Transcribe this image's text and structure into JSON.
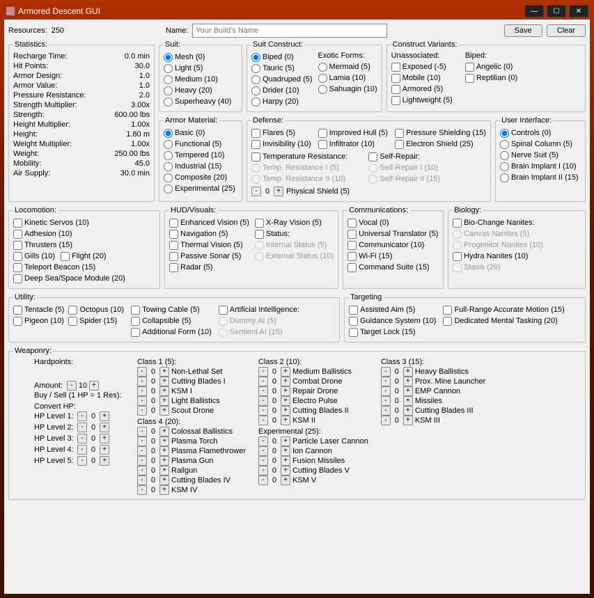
{
  "window": {
    "title": "Armored Descent GUI"
  },
  "top": {
    "resources_label": "Resources:",
    "resources_value": "250",
    "name_label": "Name:",
    "name_placeholder": "Your Build's Name",
    "save": "Save",
    "clear": "Clear"
  },
  "statistics": {
    "legend": "Statistics:",
    "rows": [
      [
        "Recharge Time:",
        "0.0 min"
      ],
      [
        "Hit Points:",
        "30.0"
      ],
      [
        "Armor Design:",
        "1.0"
      ],
      [
        "Armor Value:",
        "1.0"
      ],
      [
        "Pressure Resistance:",
        "2.0"
      ],
      [
        "Strength Multiplier:",
        "3.00x"
      ],
      [
        "Strength:",
        "600.00 lbs"
      ],
      [
        "Height Multiplier:",
        "1.00x"
      ],
      [
        "Height:",
        "1.80 m"
      ],
      [
        "Weight Multiplier:",
        "1.00x"
      ],
      [
        "Weight:",
        "250.00 lbs"
      ],
      [
        "Mobility:",
        "45.0"
      ],
      [
        "Air Supply:",
        "30.0 min"
      ]
    ]
  },
  "suit": {
    "legend": "Suit:",
    "options": [
      "Mesh (0)",
      "Light (5)",
      "Medium (10)",
      "Heavy (20)",
      "Superheavy (40)"
    ]
  },
  "suit_construct": {
    "legend": "Suit Construct:",
    "col1": [
      "Biped (0)",
      "Tauric (5)",
      "Quadruped (5)",
      "Drider (10)",
      "Harpy (20)"
    ],
    "exotic_header": "Exotic Forms:",
    "col2": [
      "Mermaid (5)",
      "Lamia (10)",
      "Sahuagin (10)"
    ]
  },
  "construct_variants": {
    "legend": "Construct Variants:",
    "unassoc_header": "Unassociated:",
    "unassoc": [
      "Exposed (-5)",
      "Mobile (10)",
      "Armored (5)",
      "Lightweight (5)"
    ],
    "biped_header": "Biped:",
    "biped": [
      "Angelic (0)",
      "Reptilian (0)"
    ]
  },
  "armor_material": {
    "legend": "Armor Material:",
    "options": [
      "Basic (0)",
      "Functional (5)",
      "Tempered (10)",
      "Industrial (15)",
      "Composite (20)",
      "Experimental (25)"
    ]
  },
  "defense": {
    "legend": "Defense:",
    "col1": [
      "Flares (5)",
      "Invisibility (10)"
    ],
    "col2": [
      "Improved Hull (5)",
      "Infiltrator (10)"
    ],
    "col3": [
      "Pressure Shielding (15)",
      "Electron Shield (25)"
    ],
    "temp_header": "Temperature Resistance:",
    "temp": [
      "Temp. Resistance I (5)",
      "Temp. Resistance II (10)"
    ],
    "self_header": "Self-Repair:",
    "self": [
      "Self-Repair I (10)",
      "Self-Repair II (15)"
    ],
    "phys_shield": "Physical Shield (5)",
    "phys_val": "0"
  },
  "ui": {
    "legend": "User Interface:",
    "options": [
      "Controls (0)",
      "Spinal Column (5)",
      "Nerve Suit (5)",
      "Brain Implant I (10)",
      "Brain Implant II (15)"
    ]
  },
  "locomotion": {
    "legend": "Locomotion:",
    "col1": [
      "Kinetic Servos (10)",
      "Adhesion (10)",
      "Thrusters (15)"
    ],
    "row": [
      "Gills (10)",
      "Flight (20)"
    ],
    "col2": [
      "Teleport Beacon (15)",
      "Deep Sea/Space Module (20)"
    ]
  },
  "hud": {
    "legend": "HUD/Visuals:",
    "col1": [
      "Enhanced Vision (5)",
      "Navigation (5)",
      "Thermal Vision (5)",
      "Passive Sonar (5)",
      "Radar (5)"
    ],
    "xray": "X-Ray Vision (5)",
    "status_header": "Status:",
    "status": [
      "Internal Status (5)",
      "External Status (10)"
    ]
  },
  "comm": {
    "legend": "Communications:",
    "options": [
      "Vocal (0)",
      "Universal Translator (5)",
      "Communicator (10)",
      "Wi-Fi (15)",
      "Command Suite (15)"
    ]
  },
  "biology": {
    "legend": "Biology:",
    "bio_header": "Bio-Change Nanites:",
    "bio": [
      "Canvas Nanites (5)",
      "Progenitor Nanites (10)"
    ],
    "hydra": "Hydra Nanites (10)",
    "stasis": "Stasis (20)"
  },
  "utility": {
    "legend": "Utility:",
    "col1": [
      [
        "Tentacle (5)",
        "Octopus (10)"
      ],
      [
        "Pigeon (10)",
        "Spider (15)"
      ]
    ],
    "col2": [
      "Towing Cable (5)",
      "Collapsible (5)",
      "Additional Form (10)"
    ],
    "ai_header": "Artificial Intelligence:",
    "ai": [
      "Dummy AI (5)",
      "Sentient AI (15)"
    ]
  },
  "targeting": {
    "legend": "Targeting",
    "col1": [
      "Assisted Aim (5)",
      "Guidance System (10)",
      "Target Lock (15)"
    ],
    "col2": [
      "Full-Range Accurate Motion (15)",
      "Dedicated Mental Tasking (20)"
    ]
  },
  "weaponry": {
    "legend": "Weaponry:",
    "hp_header": "Hardpoints:",
    "amount_label": "Amount:",
    "amount_val": "10",
    "buysell": "Buy / Sell (1 HP = 1 Res):",
    "convert_header": "Convert HP:",
    "convert": [
      "HP Level 1:",
      "HP Level 2:",
      "HP Level 3:",
      "HP Level 4:",
      "HP Level 5:"
    ],
    "convert_val": "0",
    "class1_header": "Class 1 (5):",
    "class1": [
      "Non-Lethal Set",
      "Cutting Blades I",
      "KSM I",
      "Light Ballistics",
      "Scout Drone"
    ],
    "class4_header": "Class 4 (20):",
    "class4": [
      "Colossal Ballistics",
      "Plasma Torch",
      "Plasma Flamethrower",
      "Plasma Gun",
      "Railgun",
      "Cutting Blades IV",
      "KSM IV"
    ],
    "class2_header": "Class 2 (10):",
    "class2": [
      "Medium Ballistics",
      "Combat Drone",
      "Repair Drone",
      "Electro Pulse",
      "Cutting Blades II",
      "KSM II"
    ],
    "exp_header": "Experimental (25):",
    "exp": [
      "Particle Laser Cannon",
      "Ion Cannon",
      "Fusion Missiles",
      "Cutting Blades V",
      "KSM V"
    ],
    "class3_header": "Class 3 (15):",
    "class3": [
      "Heavy Ballistics",
      "Prox. Mine Launcher",
      "EMP Cannon",
      "Missiles",
      "Cutting Blades III",
      "KSM III"
    ],
    "wval": "0"
  }
}
